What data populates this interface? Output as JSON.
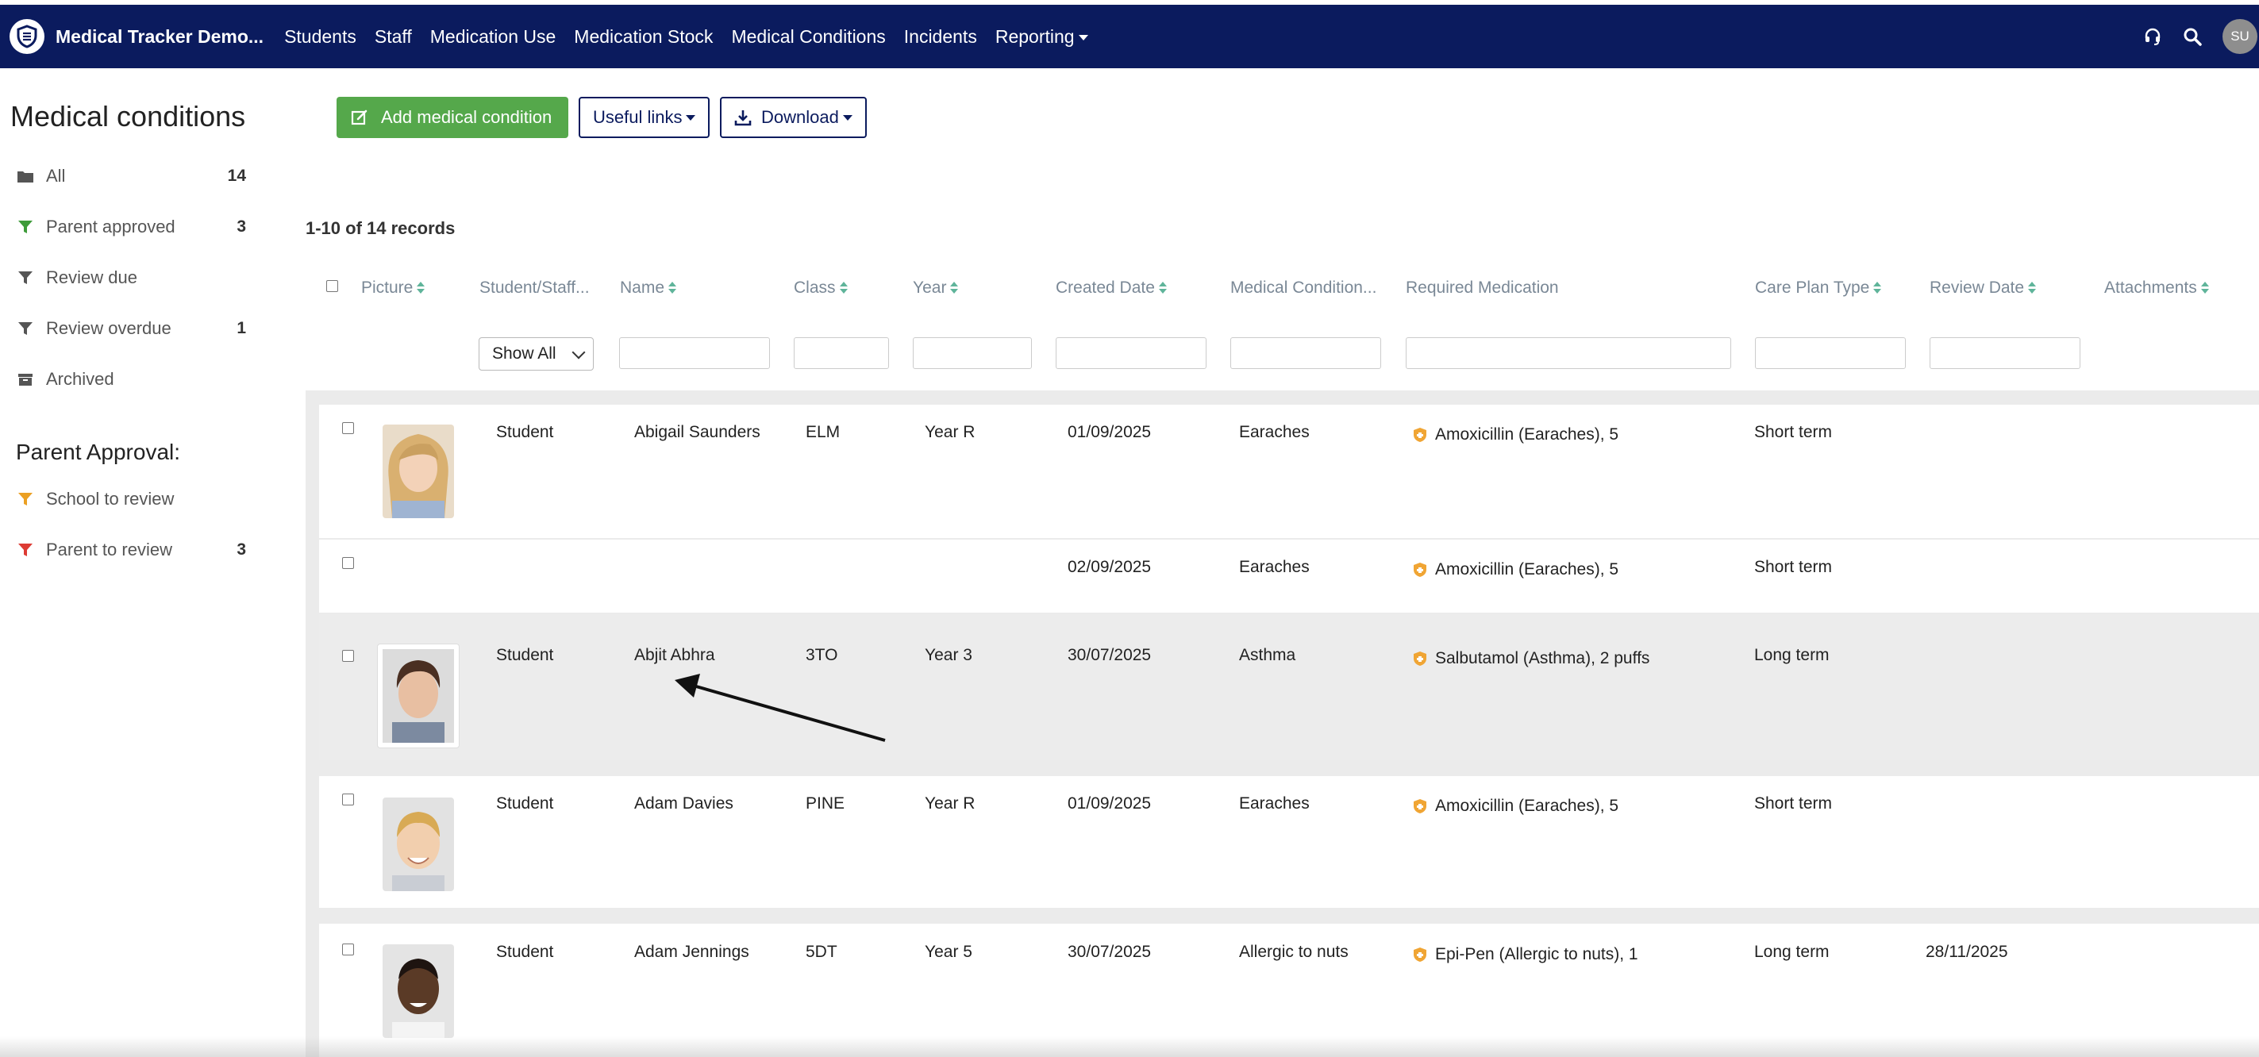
{
  "nav": {
    "brand": "Medical Tracker Demo...",
    "items": [
      "Students",
      "Staff",
      "Medication Use",
      "Medication Stock",
      "Medical Conditions",
      "Incidents",
      "Reporting"
    ],
    "avatar_initials": "SU",
    "color": "#0b1b5e"
  },
  "sidebar": {
    "title": "Medical conditions",
    "filters": [
      {
        "label": "All",
        "count": "14",
        "icon": "folder-icon"
      },
      {
        "label": "Parent approved",
        "count": "3",
        "icon": "filter-green-icon"
      },
      {
        "label": "Review due",
        "count": "",
        "icon": "filter-icon"
      },
      {
        "label": "Review overdue",
        "count": "1",
        "icon": "filter-icon"
      },
      {
        "label": "Archived",
        "count": "",
        "icon": "archive-icon"
      }
    ],
    "approval_title": "Parent Approval:",
    "approval": [
      {
        "label": "School to review",
        "count": "",
        "icon": "filter-orange-icon"
      },
      {
        "label": "Parent to review",
        "count": "3",
        "icon": "filter-red-icon"
      }
    ]
  },
  "toolbar": {
    "add_label": "Add medical condition",
    "links_label": "Useful links",
    "download_label": "Download"
  },
  "records_label": "1-10 of 14 records",
  "columns": [
    "Picture",
    "Student/Staff...",
    "Name",
    "Class",
    "Year",
    "Created Date",
    "Medical Condition...",
    "Required Medication",
    "Care Plan Type",
    "Review Date",
    "Attachments"
  ],
  "filter_select": "Show All",
  "rows": [
    {
      "type": "Student",
      "name": "Abigail Saunders",
      "class": "ELM",
      "year": "Year R",
      "created": "01/09/2025",
      "condition": "Earaches",
      "medication": "Amoxicillin (Earaches), 5",
      "care": "Short term",
      "review": "",
      "photo": "blonde-girl"
    },
    {
      "type": "",
      "name": "",
      "class": "",
      "year": "",
      "created": "02/09/2025",
      "condition": "Earaches",
      "medication": "Amoxicillin (Earaches), 5",
      "care": "Short term",
      "review": "",
      "photo": ""
    },
    {
      "type": "Student",
      "name": "Abjit Abhra",
      "class": "3TO",
      "year": "Year 3",
      "created": "30/07/2025",
      "condition": "Asthma",
      "medication": "Salbutamol (Asthma), 2 puffs",
      "care": "Long term",
      "review": "",
      "photo": "dark-hair-boy"
    },
    {
      "type": "Student",
      "name": "Adam Davies",
      "class": "PINE",
      "year": "Year R",
      "created": "01/09/2025",
      "condition": "Earaches",
      "medication": "Amoxicillin (Earaches), 5",
      "care": "Short term",
      "review": "",
      "photo": "blonde-boy"
    },
    {
      "type": "Student",
      "name": "Adam Jennings",
      "class": "5DT",
      "year": "Year 5",
      "created": "30/07/2025",
      "condition": "Allergic to nuts",
      "medication": "Epi-Pen (Allergic to nuts), 1",
      "care": "Long term",
      "review": "28/11/2025",
      "photo": "black-boy"
    }
  ]
}
